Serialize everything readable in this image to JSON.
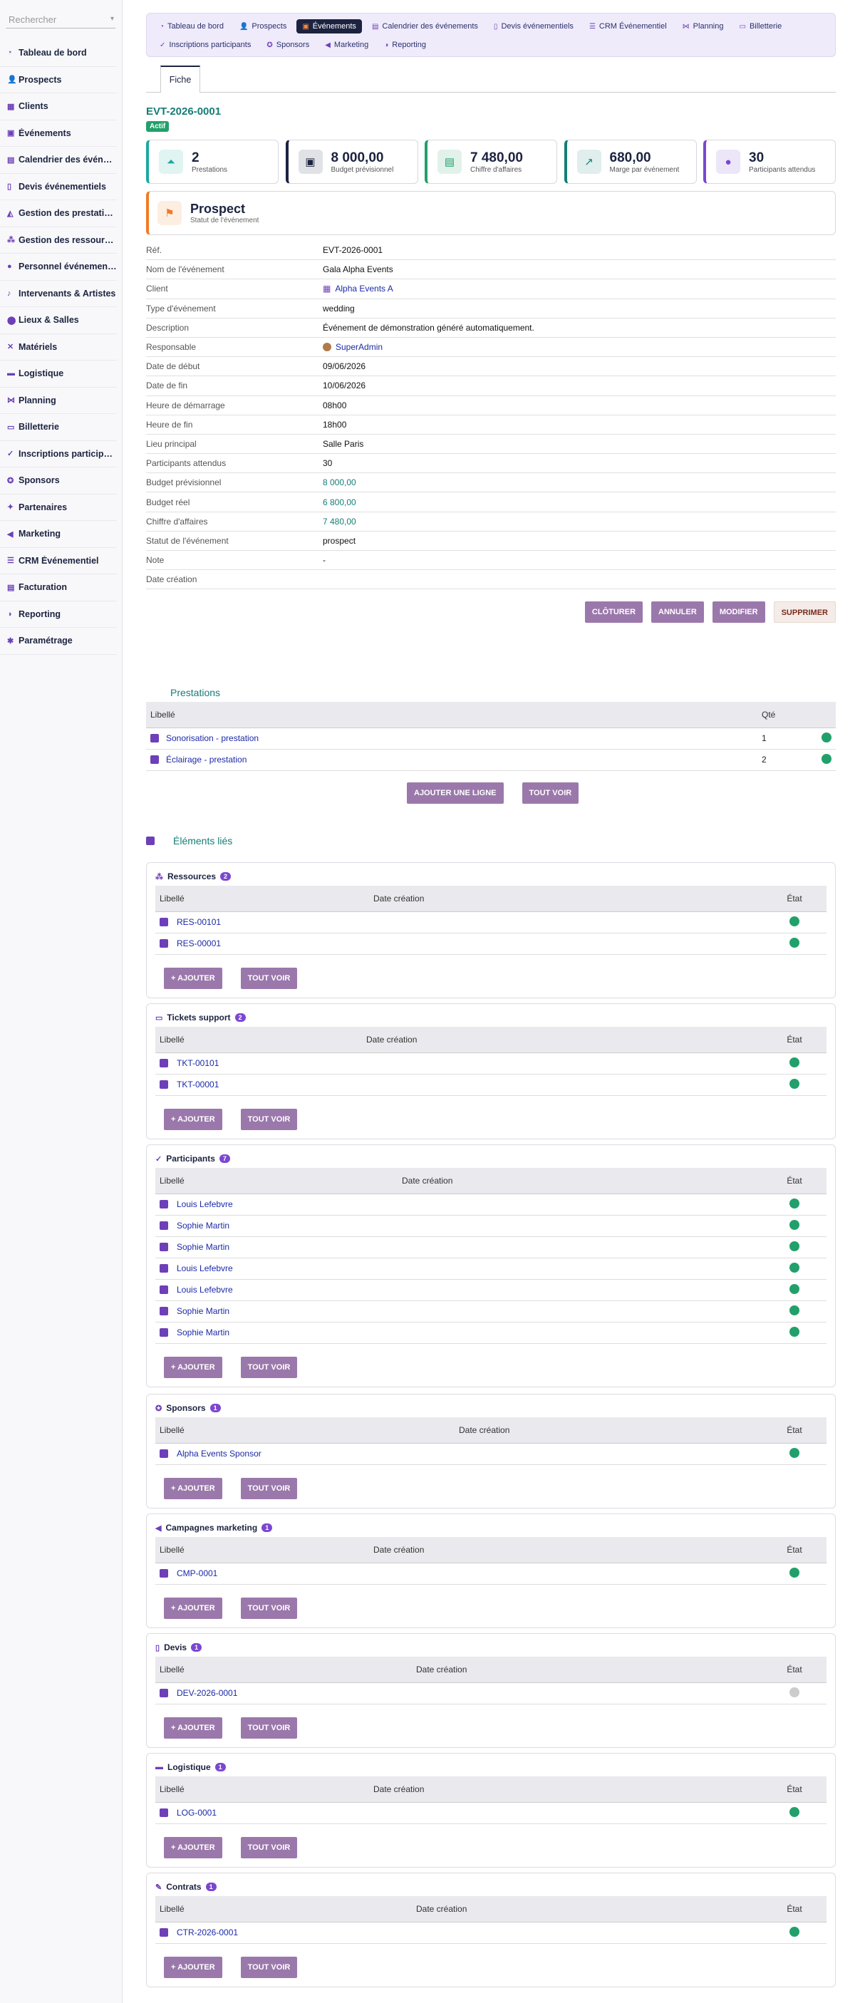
{
  "sidebar": {
    "search_placeholder": "Rechercher",
    "items": [
      {
        "label": "Tableau de bord",
        "icon": "dashboard-icon"
      },
      {
        "label": "Prospects",
        "icon": "user-plus-icon"
      },
      {
        "label": "Clients",
        "icon": "building-icon"
      },
      {
        "label": "Événements",
        "icon": "calendar-check-icon"
      },
      {
        "label": "Calendrier des événements",
        "icon": "calendar-icon"
      },
      {
        "label": "Devis événementiels",
        "icon": "file-icon"
      },
      {
        "label": "Gestion des prestations",
        "icon": "service-icon"
      },
      {
        "label": "Gestion des ressources",
        "icon": "cubes-icon"
      },
      {
        "label": "Personnel événementiel",
        "icon": "person-icon"
      },
      {
        "label": "Intervenants & Artistes",
        "icon": "microphone-icon"
      },
      {
        "label": "Lieux & Salles",
        "icon": "map-pin-icon"
      },
      {
        "label": "Matériels",
        "icon": "tools-icon"
      },
      {
        "label": "Logistique",
        "icon": "truck-icon"
      },
      {
        "label": "Planning",
        "icon": "planning-icon"
      },
      {
        "label": "Billetterie",
        "icon": "ticket-icon"
      },
      {
        "label": "Inscriptions participants",
        "icon": "user-check-icon"
      },
      {
        "label": "Sponsors",
        "icon": "award-icon"
      },
      {
        "label": "Partenaires",
        "icon": "handshake-icon"
      },
      {
        "label": "Marketing",
        "icon": "megaphone-icon"
      },
      {
        "label": "CRM Événementiel",
        "icon": "list-icon"
      },
      {
        "label": "Facturation",
        "icon": "invoice-icon"
      },
      {
        "label": "Reporting",
        "icon": "chart-pie-icon"
      },
      {
        "label": "Paramétrage",
        "icon": "gear-icon"
      }
    ]
  },
  "topnav": {
    "row1": [
      {
        "label": "Tableau de bord",
        "icon": "dashboard-icon"
      },
      {
        "label": "Prospects",
        "icon": "user-plus-icon"
      },
      {
        "label": "Événements",
        "icon": "calendar-check-icon",
        "active": true
      },
      {
        "label": "Calendrier des événements",
        "icon": "calendar-icon"
      },
      {
        "label": "Devis événementiels",
        "icon": "file-icon"
      },
      {
        "label": "CRM Événementiel",
        "icon": "list-icon"
      },
      {
        "label": "Planning",
        "icon": "planning-icon"
      },
      {
        "label": "Billetterie",
        "icon": "ticket-icon"
      }
    ],
    "row2": [
      {
        "label": "Inscriptions participants",
        "icon": "user-check-icon"
      },
      {
        "label": "Sponsors",
        "icon": "award-icon"
      },
      {
        "label": "Marketing",
        "icon": "megaphone-icon"
      },
      {
        "label": "Reporting",
        "icon": "chart-pie-icon"
      }
    ]
  },
  "tab": "Fiche",
  "record": {
    "ref": "EVT-2026-0001",
    "badge": "Actif"
  },
  "kpis": [
    {
      "value": "2",
      "label": "Prestations",
      "color": "#1aa9a1"
    },
    {
      "value": "8 000,00",
      "label": "Budget prévisionnel",
      "color": "#1c2340"
    },
    {
      "value": "7 480,00",
      "label": "Chiffre d'affaires",
      "color": "#22a06b"
    },
    {
      "value": "680,00",
      "label": "Marge par événement",
      "color": "#167d75"
    },
    {
      "value": "30",
      "label": "Participants attendus",
      "color": "#7b47d1"
    }
  ],
  "status": {
    "value": "Prospect",
    "label": "Statut de l'événement"
  },
  "fields": [
    {
      "k": "Réf.",
      "v": "EVT-2026-0001"
    },
    {
      "k": "Nom de l'événement",
      "v": "Gala Alpha Events"
    },
    {
      "k": "Client",
      "v": "Alpha Events A",
      "cls": "blue"
    },
    {
      "k": "Type d'événement",
      "v": "wedding"
    },
    {
      "k": "Description",
      "v": "Événement de démonstration généré automatiquement."
    },
    {
      "k": "Responsable",
      "v": "SuperAdmin",
      "cls": "blue"
    },
    {
      "k": "Date de début",
      "v": "09/06/2026"
    },
    {
      "k": "Date de fin",
      "v": "10/06/2026"
    },
    {
      "k": "Heure de démarrage",
      "v": "08h00"
    },
    {
      "k": "Heure de fin",
      "v": "18h00"
    },
    {
      "k": "Lieu principal",
      "v": "Salle Paris"
    },
    {
      "k": "Participants attendus",
      "v": "30"
    },
    {
      "k": "Budget prévisionnel",
      "v": "8 000,00",
      "cls": "link"
    },
    {
      "k": "Budget réel",
      "v": "6 800,00",
      "cls": "link"
    },
    {
      "k": "Chiffre d'affaires",
      "v": "7 480,00",
      "cls": "link"
    },
    {
      "k": "Statut de l'événement",
      "v": "prospect"
    },
    {
      "k": "Note",
      "v": "-"
    },
    {
      "k": "Date création",
      "v": ""
    }
  ],
  "actions": {
    "close": "Clôturer",
    "cancel": "Annuler",
    "edit": "Modifier",
    "delete": "Supprimer"
  },
  "prestations": {
    "title": "Prestations",
    "col_label": "Libellé",
    "col_qty": "Qté",
    "rows": [
      {
        "label": "Sonorisation - prestation",
        "qty": "1"
      },
      {
        "label": "Éclairage - prestation",
        "qty": "2"
      }
    ],
    "add": "Ajouter une ligne",
    "all": "Tout voir"
  },
  "linked": {
    "title": "Éléments liés",
    "col_label": "Libellé",
    "col_date": "Date création",
    "col_state": "État",
    "add": "+ Ajouter",
    "all": "Tout voir",
    "cards": [
      {
        "key": "ressources",
        "title": "Ressources",
        "count": "2",
        "icon": "cubes-icon",
        "rows": [
          "RES-00101",
          "RES-00001"
        ]
      },
      {
        "key": "tickets",
        "title": "Tickets support",
        "count": "2",
        "icon": "ticket-icon",
        "rows": [
          "TKT-00101",
          "TKT-00001"
        ]
      },
      {
        "key": "participants",
        "title": "Participants",
        "count": "7",
        "icon": "user-check-icon",
        "rows": [
          "Louis Lefebvre",
          "Sophie Martin",
          "Sophie Martin",
          "Louis Lefebvre",
          "Louis Lefebvre",
          "Sophie Martin",
          "Sophie Martin"
        ]
      },
      {
        "key": "sponsors",
        "title": "Sponsors",
        "count": "1",
        "icon": "award-icon",
        "rows": [
          "Alpha Events Sponsor"
        ]
      },
      {
        "key": "campagnes",
        "title": "Campagnes marketing",
        "count": "1",
        "icon": "megaphone-icon",
        "rows": [
          "CMP-0001"
        ]
      },
      {
        "key": "devis",
        "title": "Devis",
        "count": "1",
        "icon": "file-icon",
        "rows": [
          "DEV-2026-0001"
        ],
        "grey": true
      },
      {
        "key": "logistique",
        "title": "Logistique",
        "count": "1",
        "icon": "truck-icon",
        "rows": [
          "LOG-0001"
        ]
      },
      {
        "key": "contrats",
        "title": "Contrats",
        "count": "1",
        "icon": "contract-icon",
        "rows": [
          "CTR-2026-0001"
        ]
      }
    ]
  }
}
